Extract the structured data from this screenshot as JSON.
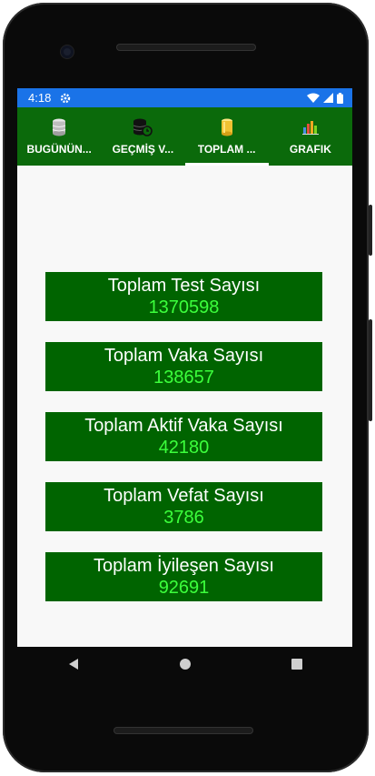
{
  "status_bar": {
    "time": "4:18",
    "icons": [
      "settings-icon",
      "wifi-icon",
      "signal-icon",
      "battery-icon"
    ],
    "color": "#1a73e8"
  },
  "tabs": [
    {
      "label": "BUGÜNÜN...",
      "icon": "database-icon",
      "active": false
    },
    {
      "label": "GEÇMİŞ V...",
      "icon": "database-history-icon",
      "active": false
    },
    {
      "label": "TOPLAM ...",
      "icon": "cylinder-icon",
      "active": true
    },
    {
      "label": "GRAFIK",
      "icon": "bar-chart-icon",
      "active": false
    }
  ],
  "stats": [
    {
      "title": "Toplam Test Sayısı",
      "value": "1370598"
    },
    {
      "title": "Toplam Vaka Sayısı",
      "value": "138657"
    },
    {
      "title": "Toplam Aktif Vaka Sayısı",
      "value": "42180"
    },
    {
      "title": "Toplam Vefat Sayısı",
      "value": "3786"
    },
    {
      "title": "Toplam İyileşen Sayısı",
      "value": "92691"
    }
  ],
  "nav": [
    "back-icon",
    "home-icon",
    "recents-icon"
  ],
  "colors": {
    "tab_bar": "#0b6a0b",
    "card_bg": "#006400",
    "card_value": "#3cff3c",
    "screen_bg": "#f8f8f8"
  }
}
